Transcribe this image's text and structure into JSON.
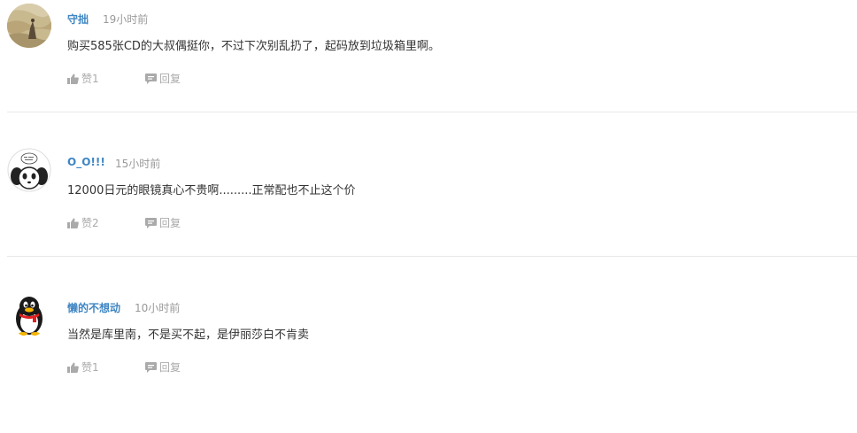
{
  "comments": [
    {
      "username": "守拙",
      "time": "19小时前",
      "content": "购买585张CD的大叔偶挺你，不过下次别乱扔了，起码放到垃圾箱里啊。",
      "like_label": "赞1",
      "reply_label": "回复"
    },
    {
      "username": "O_O!!!",
      "time": "15小时前",
      "content": "12000日元的眼镜真心不贵啊.........正常配也不止这个价",
      "like_label": "赞2",
      "reply_label": "回复"
    },
    {
      "username": "懒的不想动",
      "time": "10小时前",
      "content": "当然是库里南，不是买不起，是伊丽莎白不肯卖",
      "like_label": "赞1",
      "reply_label": "回复"
    }
  ],
  "icons": {
    "like": "thumbs-up-icon",
    "reply": "speech-bubble-icon"
  },
  "colors": {
    "username": "#3f86c3",
    "time": "#999999",
    "content": "#333333",
    "action": "#aaaaaa",
    "divider": "#e8e8e8"
  }
}
